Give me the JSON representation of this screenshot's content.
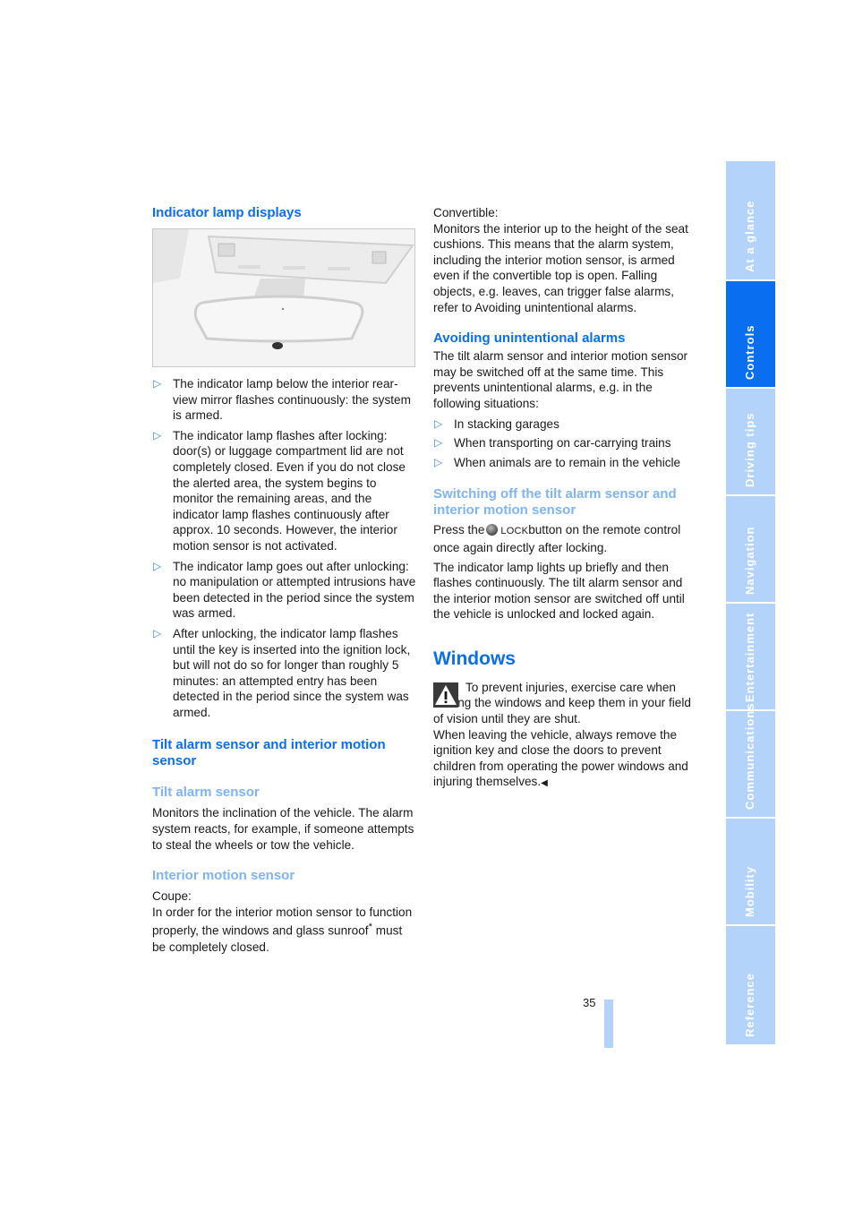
{
  "left": {
    "heading_indicator": "Indicator lamp displays",
    "indicator_bullets": [
      "The indicator lamp below the interior rear-view mirror flashes continuously: the system is armed.",
      "The indicator lamp flashes after locking: door(s) or luggage compartment lid are not completely closed. Even if you do not close the alerted area, the system begins to monitor the remaining areas, and the indicator lamp flashes continuously after approx. 10 seconds. However, the interior motion sensor is not activated.",
      "The indicator lamp goes out after unlocking: no manipulation or attempted intrusions have been detected in the period since the system was armed.",
      "After unlocking, the indicator lamp flashes until the key is inserted into the ignition lock, but will not do so for longer than roughly 5 minutes: an attempted entry has been detected in the period since the system was armed."
    ],
    "heading_tilt_interior": "Tilt alarm sensor and interior motion sensor",
    "sub_tilt": "Tilt alarm sensor",
    "tilt_text": "Monitors the inclination of the vehicle. The alarm system reacts, for example, if someone attempts to steal the wheels or tow the vehicle.",
    "sub_interior": "Interior motion sensor",
    "coupe_label": "Coupe:",
    "coupe_text": "In order for the interior motion sensor to function properly, the windows and glass sunroof",
    "coupe_star": "*",
    "coupe_text_end": "must be completely closed."
  },
  "right": {
    "convertible_label": "Convertible:",
    "convertible_text": "Monitors the interior up to the height of the seat cushions. This means that the alarm system, including the interior motion sensor, is armed even if the convertible top is open. Falling objects, e.g. leaves, can trigger false alarms, refer to Avoiding unintentional alarms.",
    "heading_avoiding": "Avoiding unintentional alarms",
    "avoiding_text": "The tilt alarm sensor and interior motion sensor may be switched off at the same time. This prevents unintentional alarms, e.g. in the following situations:",
    "avoiding_bullets": [
      "In stacking garages",
      "When transporting on car-carrying trains",
      "When animals are to remain in the vehicle"
    ],
    "sub_switching": "Switching off the tilt alarm sensor and interior motion sensor",
    "press_pre": "Press the",
    "lock_label": "LOCK",
    "press_post": "button on the remote control once again directly after locking.",
    "switching_text": "The indicator lamp lights up briefly and then flashes continuously. The tilt alarm sensor and the interior motion sensor are switched off until the vehicle is unlocked and locked again.",
    "heading_windows": "Windows",
    "warning_text": "To prevent injuries, exercise care when closing the windows and keep them in your field of vision until they are shut.",
    "windows_text": "When leaving the vehicle, always remove the ignition key and close the doors to prevent children from operating the power windows and injuring themselves.",
    "end_mark": "◀"
  },
  "bullet_glyph": "▷",
  "side_tabs": [
    {
      "label": "At a glance",
      "active": false
    },
    {
      "label": "Controls",
      "active": true
    },
    {
      "label": "Driving tips",
      "active": false
    },
    {
      "label": "Navigation",
      "active": false
    },
    {
      "label": "Entertainment",
      "active": false
    },
    {
      "label": "Communications",
      "active": false
    },
    {
      "label": "Mobility",
      "active": false
    },
    {
      "label": "Reference",
      "active": false
    }
  ],
  "page_number": "35",
  "colors": {
    "heading_blue": "#0a6ef0",
    "subheading_blue": "#7fb4f2",
    "tab_inactive": "#b3d3fb",
    "tab_active": "#0a6ef0"
  }
}
